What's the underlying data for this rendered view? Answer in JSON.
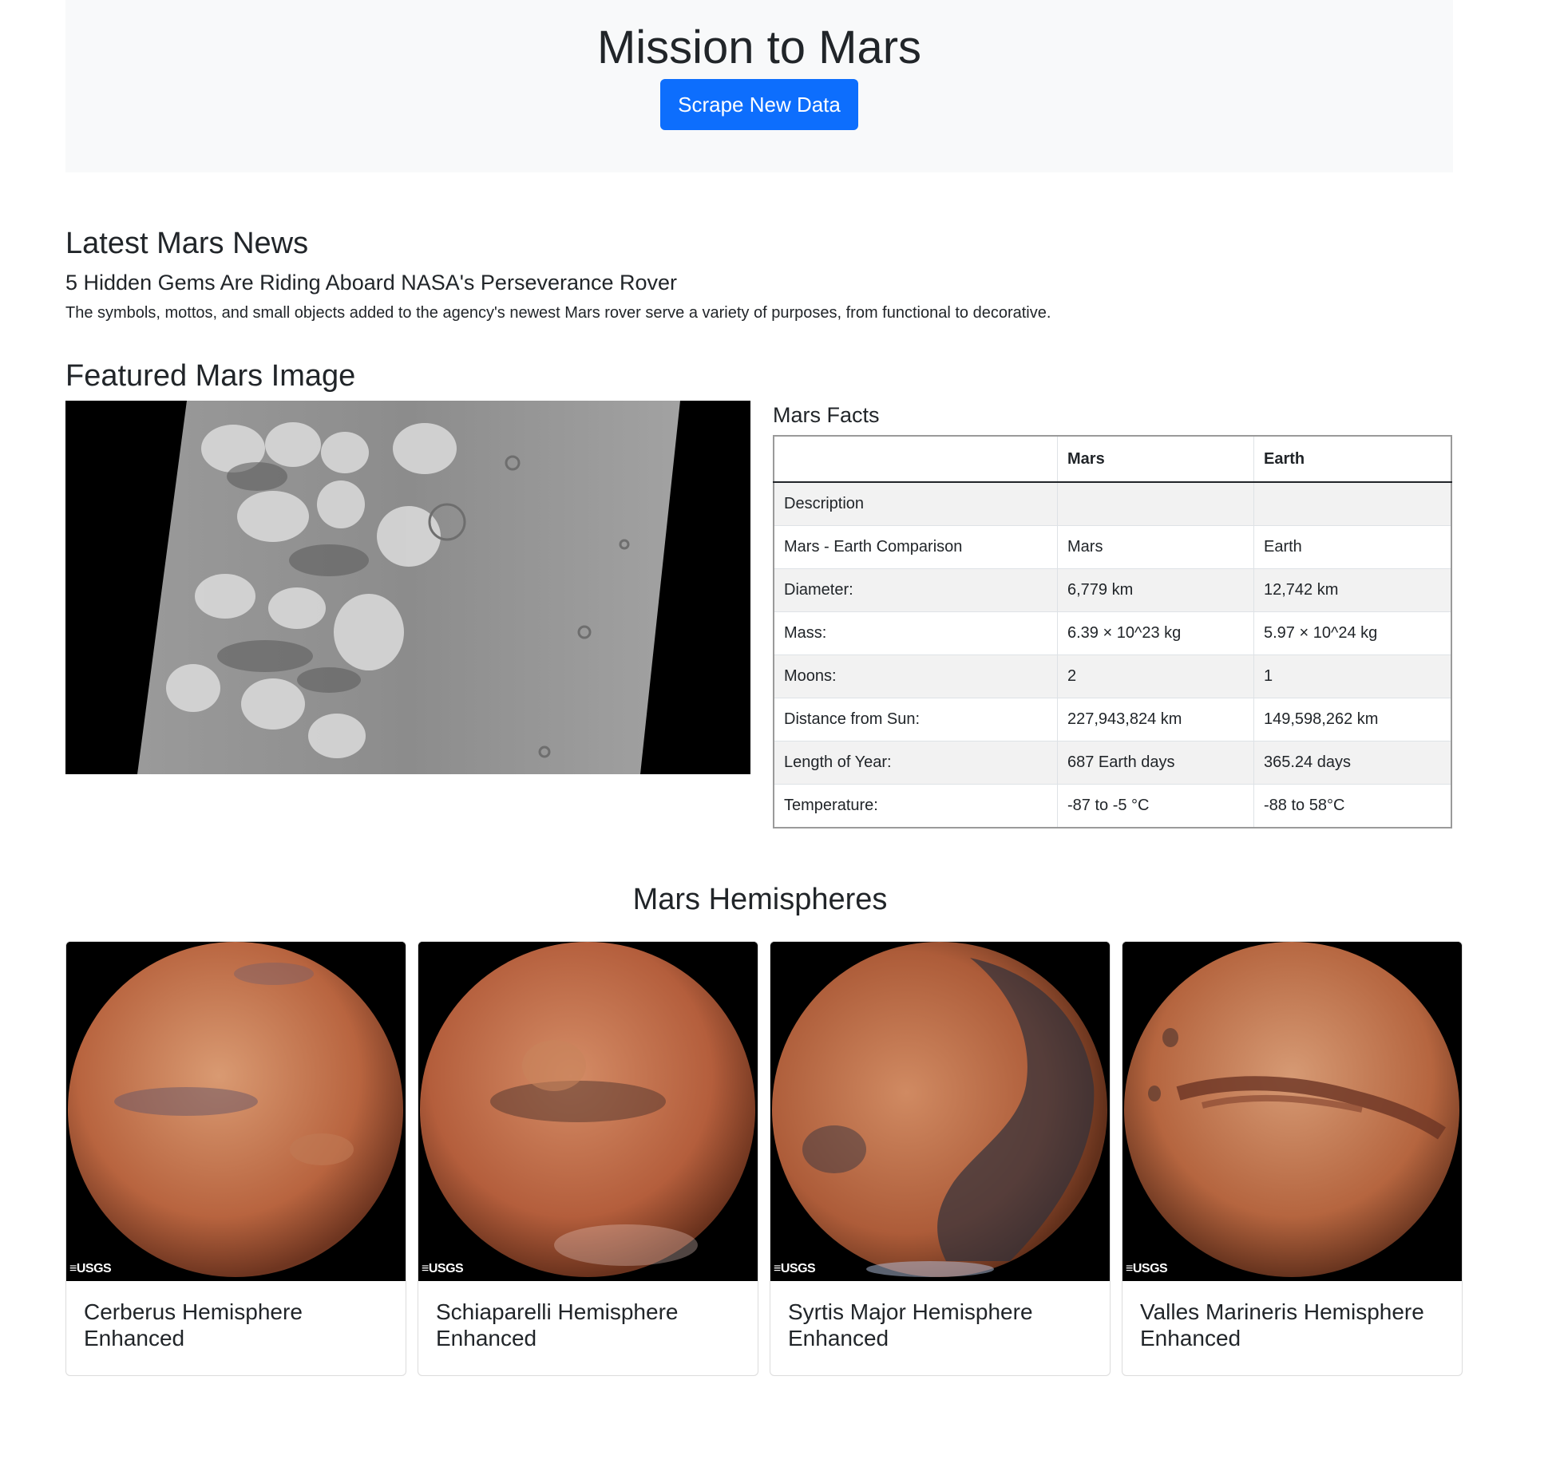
{
  "header": {
    "title": "Mission to Mars",
    "scrape_button": "Scrape New Data"
  },
  "news": {
    "section_title": "Latest Mars News",
    "headline": "5 Hidden Gems Are Riding Aboard NASA's Perseverance Rover",
    "teaser": "The symbols, mottos, and small objects added to the agency's newest Mars rover serve a variety of purposes, from functional to decorative."
  },
  "featured": {
    "section_title": "Featured Mars Image"
  },
  "facts": {
    "title": "Mars Facts",
    "headers": [
      "",
      "Mars",
      "Earth"
    ],
    "rows": [
      [
        "Description",
        "",
        ""
      ],
      [
        "Mars - Earth Comparison",
        "Mars",
        "Earth"
      ],
      [
        "Diameter:",
        "6,779 km",
        "12,742 km"
      ],
      [
        "Mass:",
        "6.39 × 10^23 kg",
        "5.97 × 10^24 kg"
      ],
      [
        "Moons:",
        "2",
        "1"
      ],
      [
        "Distance from Sun:",
        "227,943,824 km",
        "149,598,262 km"
      ],
      [
        "Length of Year:",
        "687 Earth days",
        "365.24 days"
      ],
      [
        "Temperature:",
        "-87 to -5 °C",
        "-88 to 58°C"
      ]
    ]
  },
  "hemispheres": {
    "section_title": "Mars Hemispheres",
    "logo_text": "≡USGS",
    "items": [
      {
        "title": "Cerberus Hemisphere Enhanced"
      },
      {
        "title": "Schiaparelli Hemisphere Enhanced"
      },
      {
        "title": "Syrtis Major Hemisphere Enhanced"
      },
      {
        "title": "Valles Marineris Hemisphere Enhanced"
      }
    ]
  },
  "colors": {
    "primary_button": "#0d6efd",
    "jumbotron_bg": "#f8f9fa",
    "mars_surface": "#c6714a"
  }
}
